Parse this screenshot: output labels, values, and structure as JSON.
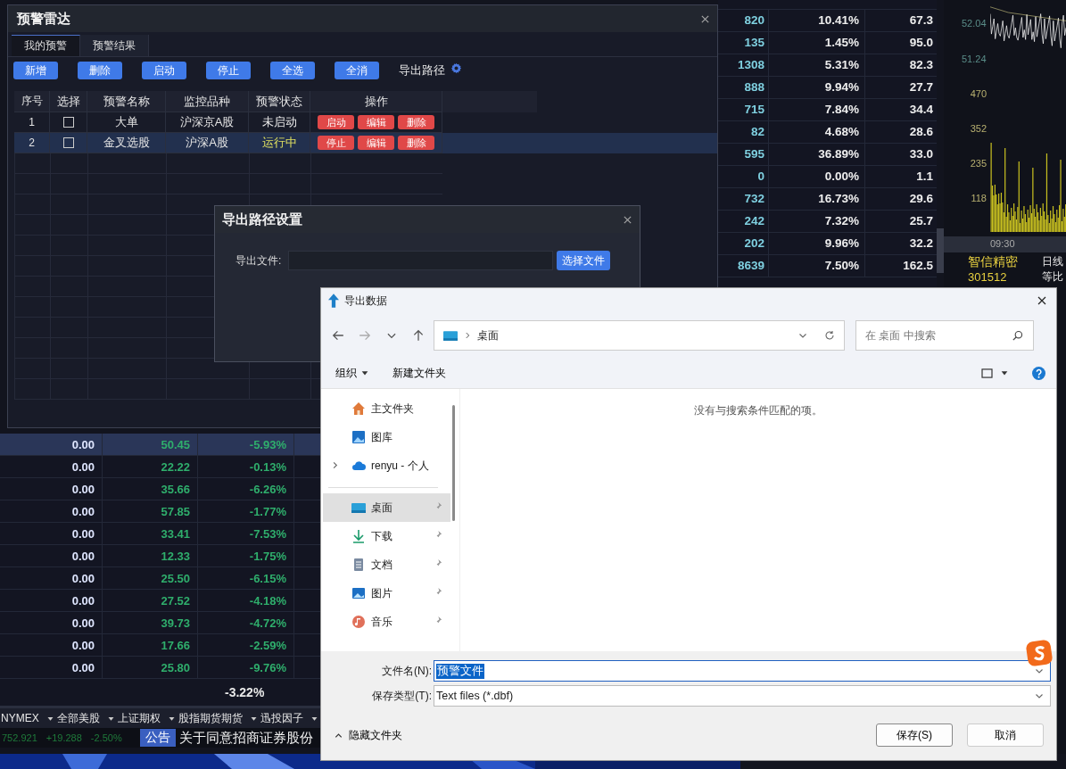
{
  "app": {
    "right_table": {
      "rows": [
        [
          "820",
          "10.41%",
          "67.3"
        ],
        [
          "135",
          "1.45%",
          "95.0"
        ],
        [
          "1308",
          "5.31%",
          "82.3"
        ],
        [
          "888",
          "9.94%",
          "27.7"
        ],
        [
          "715",
          "7.84%",
          "34.4"
        ],
        [
          "82",
          "4.68%",
          "28.6"
        ],
        [
          "595",
          "36.89%",
          "33.0"
        ],
        [
          "0",
          "0.00%",
          "1.1"
        ],
        [
          "732",
          "16.73%",
          "29.6"
        ],
        [
          "242",
          "7.32%",
          "25.7"
        ],
        [
          "202",
          "9.96%",
          "32.2"
        ],
        [
          "8639",
          "7.50%",
          "162.5"
        ]
      ]
    },
    "chart": {
      "price_labels": [
        "52.04",
        "51.24"
      ],
      "volume_labels": [
        "470",
        "352",
        "235",
        "118"
      ],
      "time_label": "09:30"
    },
    "stock": {
      "name": "智信精密",
      "code": "301512",
      "tags": [
        "日线",
        "等比"
      ]
    },
    "lower_table": {
      "rows": [
        {
          "cells": [
            "0.00",
            "50.45",
            "-5.93%"
          ],
          "selected": true
        },
        {
          "cells": [
            "0.00",
            "22.22",
            "-0.13%"
          ],
          "selected": false
        },
        {
          "cells": [
            "0.00",
            "35.66",
            "-6.26%"
          ],
          "selected": false
        },
        {
          "cells": [
            "0.00",
            "57.85",
            "-1.77%"
          ],
          "selected": false
        },
        {
          "cells": [
            "0.00",
            "33.41",
            "-7.53%"
          ],
          "selected": false
        },
        {
          "cells": [
            "0.00",
            "12.33",
            "-1.75%"
          ],
          "selected": false
        },
        {
          "cells": [
            "0.00",
            "25.50",
            "-6.15%"
          ],
          "selected": false
        },
        {
          "cells": [
            "0.00",
            "27.52",
            "-4.18%"
          ],
          "selected": false
        },
        {
          "cells": [
            "0.00",
            "39.73",
            "-4.72%"
          ],
          "selected": false
        },
        {
          "cells": [
            "0.00",
            "17.66",
            "-2.59%"
          ],
          "selected": false
        },
        {
          "cells": [
            "0.00",
            "25.80",
            "-9.76%"
          ],
          "selected": false
        }
      ],
      "total": "-3.22%"
    },
    "market_tabs": [
      "NYMEX",
      "全部美股",
      "上证期权",
      "股指期货期货",
      "迅投因子"
    ],
    "status": {
      "quotes": [
        "752.921",
        "+19.288",
        "-2.50%"
      ],
      "notice_badge": "公告",
      "notice": "关于同意招商证券股份"
    }
  },
  "alert_window": {
    "title": "预警雷达",
    "tabs": [
      {
        "label": "我的预警",
        "selected": true
      },
      {
        "label": "预警结果",
        "selected": false
      }
    ],
    "toolbar_buttons": [
      "新增",
      "删除",
      "启动",
      "停止",
      "全选",
      "全消"
    ],
    "export_path_label": "导出路径",
    "columns": [
      "序号",
      "选择",
      "预警名称",
      "监控品种",
      "预警状态",
      "操作"
    ],
    "rows": [
      {
        "index": "1",
        "checked": false,
        "name": "大单",
        "market": "沪深京A股",
        "status": "未启动",
        "active": false,
        "actions": [
          "启动",
          "编辑",
          "删除"
        ],
        "selected": false
      },
      {
        "index": "2",
        "checked": false,
        "name": "金叉选股",
        "market": "沪深A股",
        "status": "运行中",
        "active": true,
        "actions": [
          "停止",
          "编辑",
          "删除"
        ],
        "selected": true
      }
    ]
  },
  "export_dialog": {
    "title": "导出路径设置",
    "field_label": "导出文件:",
    "button": "选择文件"
  },
  "file_dialog": {
    "title": "导出数据",
    "breadcrumb": "桌面",
    "search_placeholder": "在 桌面 中搜索",
    "toolbar": [
      "组织",
      "新建文件夹"
    ],
    "nav": [
      {
        "label": "主文件夹",
        "kind": "home",
        "selected": false,
        "pinned": false,
        "expandable": false
      },
      {
        "label": "图库",
        "kind": "gallery",
        "selected": false,
        "pinned": false,
        "expandable": false
      },
      {
        "label": "renyu - 个人",
        "kind": "cloud",
        "selected": false,
        "pinned": false,
        "expandable": true
      },
      {
        "label": "桌面",
        "kind": "desktop",
        "selected": true,
        "pinned": true,
        "expandable": false
      },
      {
        "label": "下载",
        "kind": "download",
        "selected": false,
        "pinned": true,
        "expandable": false
      },
      {
        "label": "文档",
        "kind": "document",
        "selected": false,
        "pinned": true,
        "expandable": false
      },
      {
        "label": "图片",
        "kind": "picture",
        "selected": false,
        "pinned": true,
        "expandable": false
      },
      {
        "label": "音乐",
        "kind": "music",
        "selected": false,
        "pinned": true,
        "expandable": false
      }
    ],
    "empty_message": "没有与搜索条件匹配的项。",
    "filename_label": "文件名(N):",
    "filename": "预警文件",
    "filetype_label": "保存类型(T):",
    "filetype": "Text files (*.dbf)",
    "hide_folders": "隐藏文件夹",
    "save": "保存(S)",
    "cancel": "取消"
  }
}
